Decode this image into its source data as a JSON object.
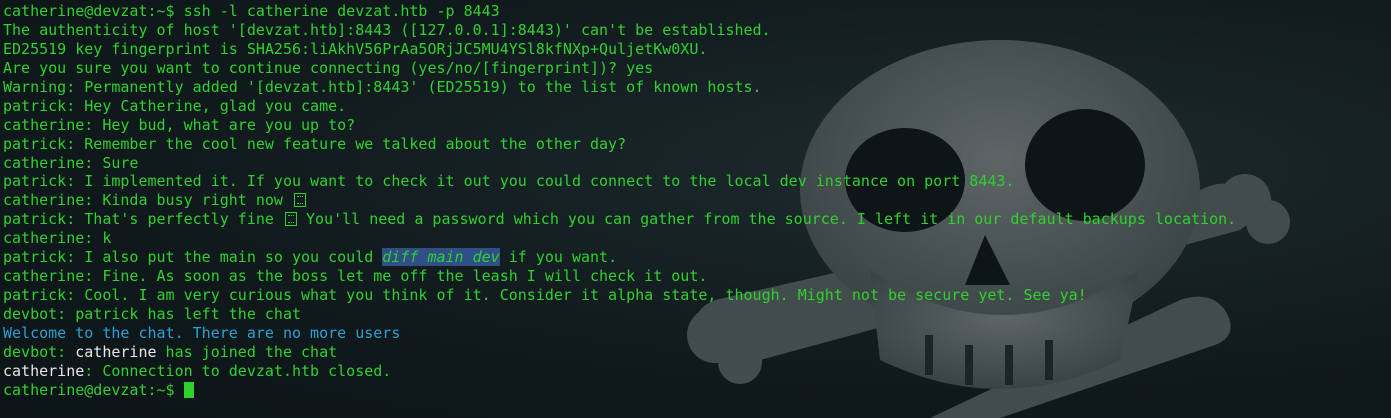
{
  "terminal": {
    "theme_colors": {
      "text_green": "#2fd12f",
      "text_white": "#e8e8e8",
      "text_blue": "#2aa1d6",
      "highlight_bg": "#2f4f86",
      "background": "#10191c"
    },
    "background_image": "skull-and-crossbones",
    "prompt": "catherine@devzat:~$",
    "lines": {
      "l1": "catherine@devzat:~$ ssh -l catherine devzat.htb -p 8443",
      "l2": "The authenticity of host '[devzat.htb]:8443 ([127.0.0.1]:8443)' can't be established.",
      "l3": "ED25519 key fingerprint is SHA256:liAkhV56PrAa5ORjJC5MU4YSl8kfNXp+QuljetKw0XU.",
      "l4": "Are you sure you want to continue connecting (yes/no/[fingerprint])? yes",
      "l5": "Warning: Permanently added '[devzat.htb]:8443' (ED25519) to the list of known hosts.",
      "l6": "patrick: Hey Catherine, glad you came.",
      "l7": "catherine: Hey bud, what are you up to?",
      "l8": "patrick: Remember the cool new feature we talked about the other day?",
      "l9": "catherine: Sure",
      "l10": "patrick: I implemented it. If you want to check it out you could connect to the local dev instance on port 8443.",
      "l11": "catherine: Kinda busy right now",
      "l12_a": "patrick: That's perfectly fine",
      "l12_b": " You'll need a password which you can gather from the source. I left it in our default backups location.",
      "l13": "catherine: k",
      "l14_a": "patrick: I also put the main so you could ",
      "l14_hl": "diff main dev",
      "l14_b": " if you want.",
      "l15": "catherine: Fine. As soon as the boss let me off the leash I will check it out.",
      "l16": "patrick: Cool. I am very curious what you think of it. Consider it alpha state, though. Might not be secure yet. See ya!",
      "l17": "devbot: patrick has left the chat",
      "l18": "Welcome to the chat. There are no more users",
      "l19_a": "devbot: ",
      "l19_b": "catherine",
      "l19_c": " has joined the chat",
      "l20_a": "catherine",
      "l20_b": ": Connection to devzat.htb closed.",
      "l21": "catherine@devzat:~$ "
    }
  }
}
